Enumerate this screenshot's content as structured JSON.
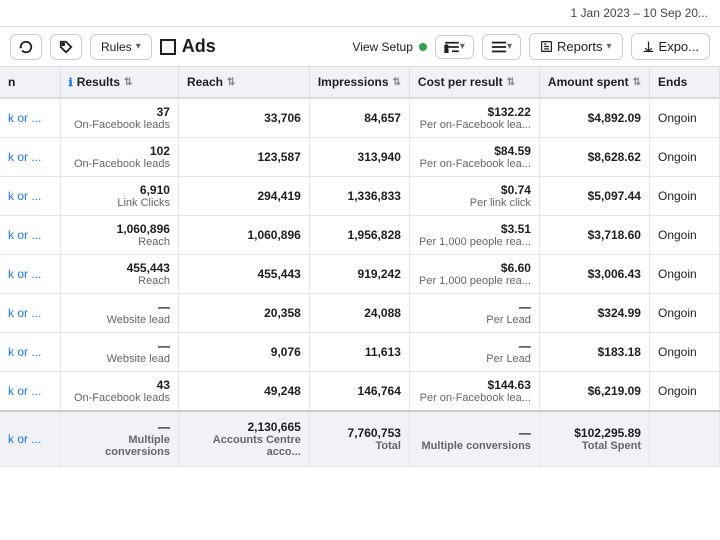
{
  "topbar": {
    "date_range": "1 Jan 2023 – 10 Sep 20..."
  },
  "toolbar": {
    "ads_title": "Ads",
    "rules_label": "Rules",
    "view_setup_label": "View Setup",
    "reports_label": "Reports",
    "export_label": "Expo..."
  },
  "table": {
    "columns": [
      {
        "id": "name",
        "label": "n"
      },
      {
        "id": "results",
        "label": "Results",
        "has_info": true
      },
      {
        "id": "reach",
        "label": "Reach"
      },
      {
        "id": "impressions",
        "label": "Impressions"
      },
      {
        "id": "cpr",
        "label": "Cost per result"
      },
      {
        "id": "amount",
        "label": "Amount spent"
      },
      {
        "id": "ends",
        "label": "Ends"
      }
    ],
    "rows": [
      {
        "name": "k or ...",
        "results_main": "37",
        "results_sub": "On-Facebook leads",
        "reach": "33,706",
        "impressions": "84,657",
        "cpr_main": "$132.22",
        "cpr_sub": "Per on-Facebook lea...",
        "amount": "$4,892.09",
        "ends": "Ongoin"
      },
      {
        "name": "k or ...",
        "results_main": "102",
        "results_sub": "On-Facebook leads",
        "reach": "123,587",
        "impressions": "313,940",
        "cpr_main": "$84.59",
        "cpr_sub": "Per on-Facebook lea...",
        "amount": "$8,628.62",
        "ends": "Ongoin"
      },
      {
        "name": "k or ...",
        "results_main": "6,910",
        "results_sub": "Link Clicks",
        "reach": "294,419",
        "impressions": "1,336,833",
        "cpr_main": "$0.74",
        "cpr_sub": "Per link click",
        "amount": "$5,097.44",
        "ends": "Ongoin"
      },
      {
        "name": "k or ...",
        "results_main": "1,060,896",
        "results_sub": "Reach",
        "reach": "1,060,896",
        "impressions": "1,956,828",
        "cpr_main": "$3.51",
        "cpr_sub": "Per 1,000 people rea...",
        "amount": "$3,718.60",
        "ends": "Ongoin"
      },
      {
        "name": "k or ...",
        "results_main": "455,443",
        "results_sub": "Reach",
        "reach": "455,443",
        "impressions": "919,242",
        "cpr_main": "$6.60",
        "cpr_sub": "Per 1,000 people rea...",
        "amount": "$3,006.43",
        "ends": "Ongoin"
      },
      {
        "name": "k or ...",
        "results_main": "—",
        "results_sub": "Website lead",
        "reach": "20,358",
        "impressions": "24,088",
        "cpr_main": "—",
        "cpr_sub": "Per Lead",
        "amount": "$324.99",
        "ends": "Ongoin"
      },
      {
        "name": "k or ...",
        "results_main": "—",
        "results_sub": "Website lead",
        "reach": "9,076",
        "impressions": "11,613",
        "cpr_main": "—",
        "cpr_sub": "Per Lead",
        "amount": "$183.18",
        "ends": "Ongoin"
      },
      {
        "name": "k or ...",
        "results_main": "43",
        "results_sub": "On-Facebook leads",
        "reach": "49,248",
        "impressions": "146,764",
        "cpr_main": "$144.63",
        "cpr_sub": "Per on-Facebook lea...",
        "amount": "$6,219.09",
        "ends": "Ongoin"
      }
    ],
    "total": {
      "name": "k or ...",
      "results_main": "—",
      "results_sub": "Multiple conversions",
      "reach": "2,130,665",
      "reach_sub": "Accounts Centre acco...",
      "impressions": "7,760,753",
      "impressions_sub": "Total",
      "cpr_main": "—",
      "cpr_sub": "Multiple conversions",
      "amount": "$102,295.89",
      "amount_sub": "Total Spent",
      "ends": ""
    }
  }
}
